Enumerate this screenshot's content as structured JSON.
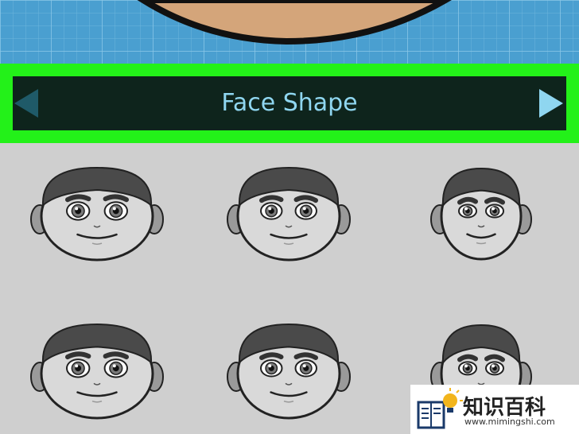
{
  "header": {
    "title": "Face Shape"
  },
  "colors": {
    "highlight": "#23f119",
    "bar": "#0e241c",
    "accent": "#8fd6f0",
    "grid_bg": "#4aa0d0",
    "skin": "#d4a57a"
  },
  "face_options": [
    {
      "name": "face-option-1"
    },
    {
      "name": "face-option-2"
    },
    {
      "name": "face-option-3"
    },
    {
      "name": "face-option-4"
    },
    {
      "name": "face-option-5"
    },
    {
      "name": "face-option-6"
    }
  ],
  "watermark": {
    "text": "知识百科",
    "url": "www.mimingshi.com"
  }
}
